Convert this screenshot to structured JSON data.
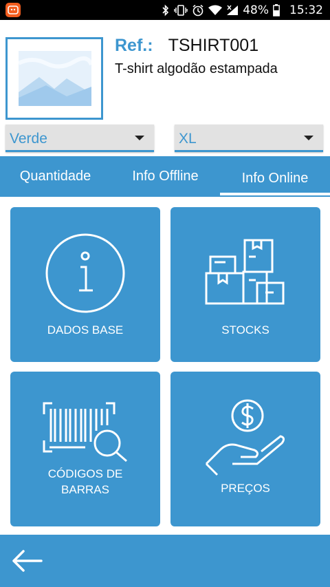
{
  "status_bar": {
    "battery": "48%",
    "time": "15:32",
    "icons": [
      "app-notification-icon",
      "bluetooth-icon",
      "vibrate-icon",
      "alarm-icon",
      "wifi-icon",
      "signal-icon",
      "battery-icon"
    ]
  },
  "product": {
    "ref_label": "Ref.:",
    "ref_value": "TSHIRT001",
    "name": "T-shirt algodão estampada"
  },
  "selects": {
    "color": "Verde",
    "size": "XL"
  },
  "tabs": [
    {
      "label": "Quantidade",
      "active": false
    },
    {
      "label": "Info Offline",
      "active": false
    },
    {
      "label": "Info Online",
      "active": true
    }
  ],
  "tiles": {
    "dados_base": "DADOS BASE",
    "stocks": "STOCKS",
    "codigos_line1": "CÓDIGOS DE",
    "codigos_line2": "BARRAS",
    "precos": "PREÇOS"
  },
  "colors": {
    "accent": "#3d96cf",
    "app_badge": "#f25d1e"
  }
}
